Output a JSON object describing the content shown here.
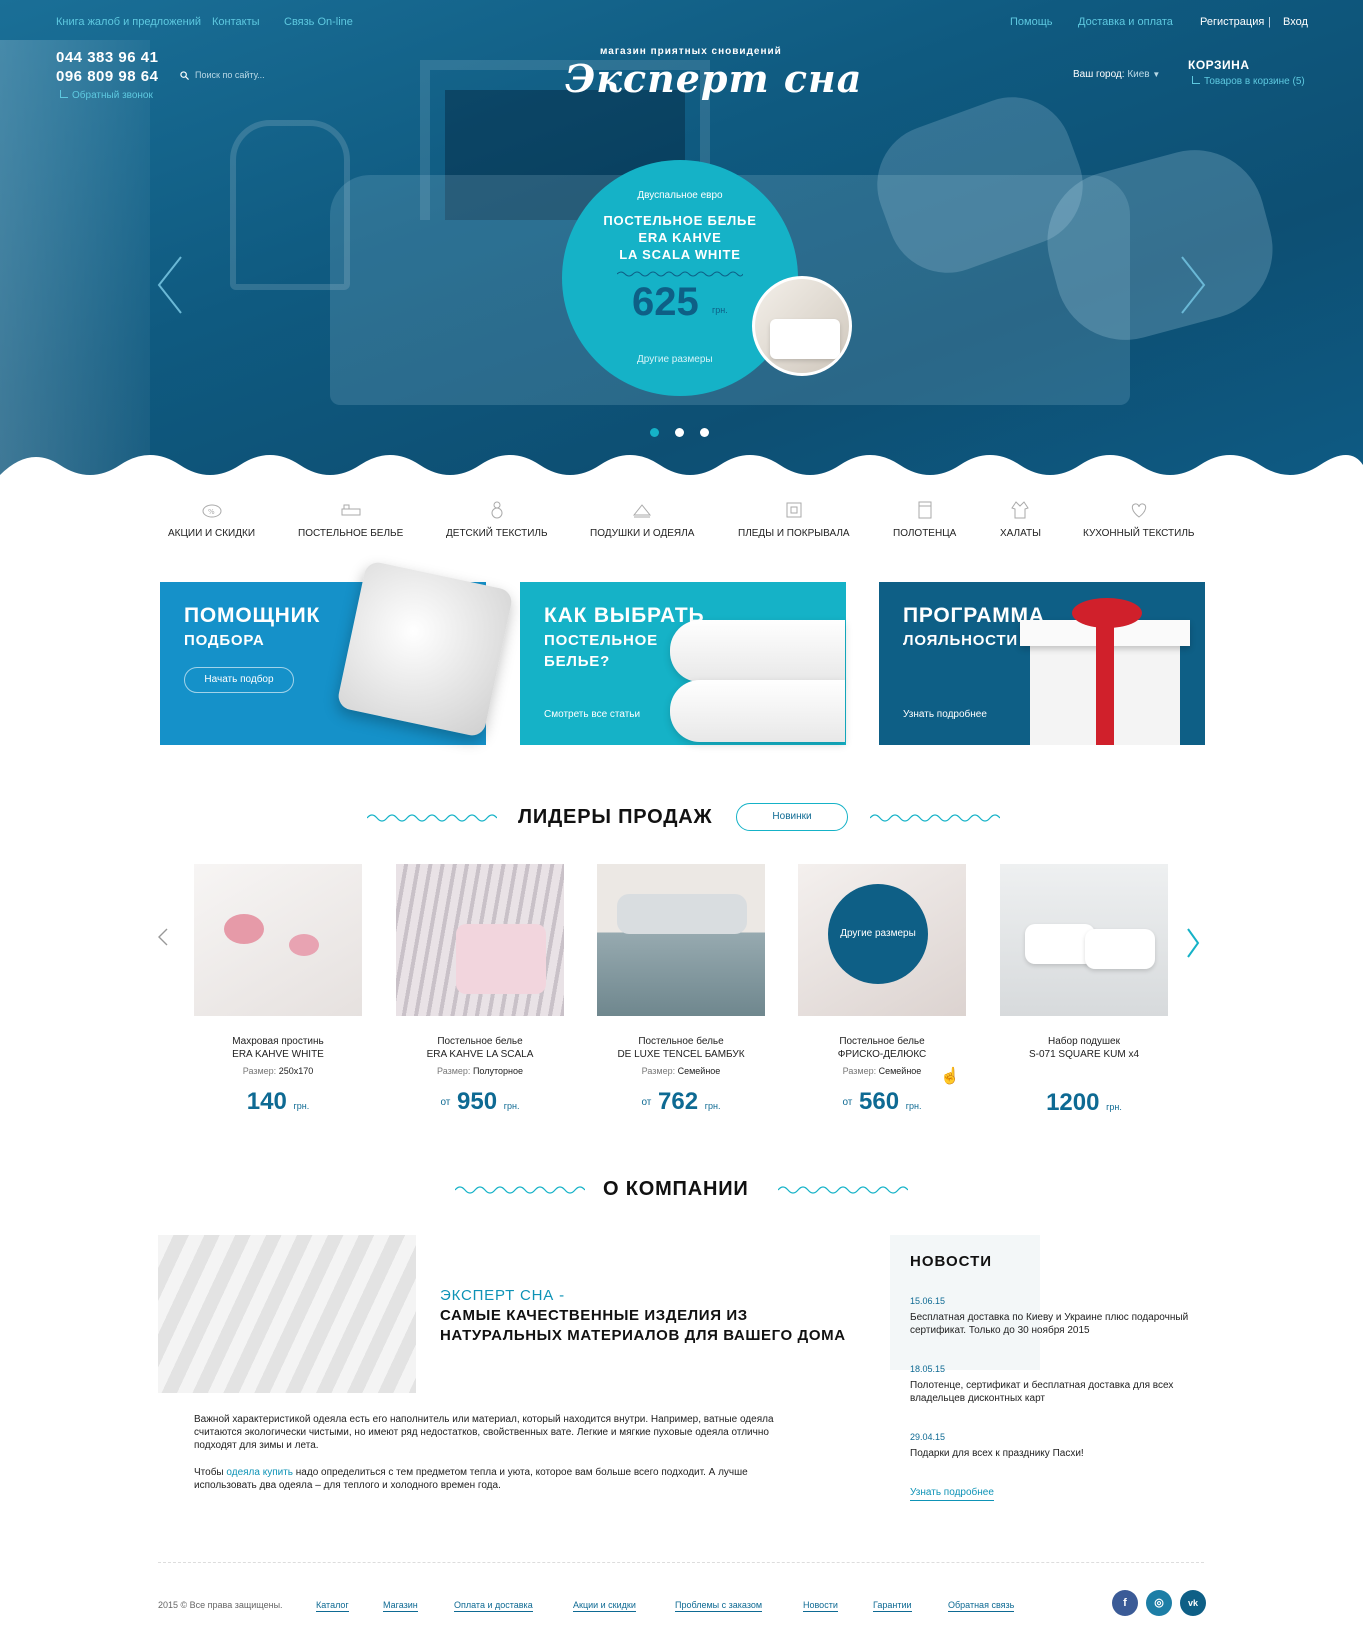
{
  "topbar": {
    "complaints": "Книга жалоб и предложений",
    "contacts": "Контакты",
    "online": "Связь On-line",
    "help": "Помощь",
    "delivery": "Доставка и оплата",
    "register": "Регистрация",
    "separator": "|",
    "login": "Вход"
  },
  "header": {
    "phone1": "044 383 96 41",
    "phone2": "096 809 98 64",
    "callback": "Обратный звонок",
    "search_placeholder": "Поиск по сайту...",
    "logo_sub": "магазин приятных сновидений",
    "logo": "Эксперт сна",
    "city_label": "Ваш город:",
    "city_value": "Киев",
    "cart_title": "КОРЗИНА",
    "cart_items": "Товаров в корзине (5)"
  },
  "slider": {
    "pre": "Двуспальное евро",
    "name_line1": "ПОСТЕЛЬНОЕ БЕЛЬЕ",
    "name_line2": "ERA KAHVE",
    "name_line3": "LA SCALA WHITE",
    "price": "625",
    "currency": "грн.",
    "sizes_link": "Другие размеры",
    "slides_total": 3,
    "active_slide": 1
  },
  "categories": [
    {
      "label": "АКЦИИ И СКИДКИ",
      "icon": "discount-tag-icon"
    },
    {
      "label": "ПОСТЕЛЬНОЕ БЕЛЬЕ",
      "icon": "bed-icon"
    },
    {
      "label": "ДЕТСКИЙ ТЕКСТИЛЬ",
      "icon": "baby-icon"
    },
    {
      "label": "ПОДУШКИ И ОДЕЯЛА",
      "icon": "pillow-icon"
    },
    {
      "label": "ПЛЕДЫ И ПОКРЫВАЛА",
      "icon": "blanket-icon"
    },
    {
      "label": "ПОЛОТЕНЦА",
      "icon": "towel-icon"
    },
    {
      "label": "ХАЛАТЫ",
      "icon": "robe-icon"
    },
    {
      "label": "КУХОННЫЙ ТЕКСТИЛЬ",
      "icon": "kitchen-icon"
    }
  ],
  "banners": {
    "b1_title": "ПОМОЩНИК",
    "b1_sub": "ПОДБОРА",
    "b1_btn": "Начать подбор",
    "b2_title": "КАК ВЫБРАТЬ",
    "b2_sub1": "ПОСТЕЛЬНОЕ",
    "b2_sub2": "БЕЛЬЕ?",
    "b2_link": "Смотреть все статьи",
    "b3_title": "ПРОГРАММА",
    "b3_sub": "ЛОЯЛЬНОСТИ",
    "b3_link": "Узнать подробнее"
  },
  "leaders": {
    "title": "ЛИДЕРЫ ПРОДАЖ",
    "new_btn": "Новинки",
    "size_label": "Размер:",
    "from": "от",
    "currency": "грн.",
    "other_sizes": "Другие размеры",
    "products": [
      {
        "n1": "Махровая простинь",
        "n2": "ERA KAHVE WHITE",
        "size": "250x170",
        "price": "140",
        "from": false
      },
      {
        "n1": "Постельное белье",
        "n2": "ERA KAHVE LA SCALA",
        "size": "Полуторное",
        "price": "950",
        "from": true
      },
      {
        "n1": "Постельное белье",
        "n2": "DE LUXE TENCEL БАМБУК",
        "size": "Семейное",
        "price": "762",
        "from": true
      },
      {
        "n1": "Постельное белье",
        "n2": "ФРИСКО-ДЕЛЮКС",
        "size": "Семейное",
        "price": "560",
        "from": true
      },
      {
        "n1": "Набор подушек",
        "n2": "S-071 SQUARE KUM x4",
        "size": "",
        "price": "1200",
        "from": false
      }
    ]
  },
  "about": {
    "title": "О КОМПАНИИ",
    "h1": "ЭКСПЕРТ СНА  -",
    "h2": "САМЫЕ КАЧЕСТВЕННЫЕ ИЗДЕЛИЯ ИЗ НАТУРАЛЬНЫХ МАТЕРИАЛОВ ДЛЯ ВАШЕГО ДОМА",
    "p1": "Важной характеристикой одеяла есть его наполнитель или материал, который находится внутри. Например, ватные одеяла считаются экологически чистыми, но имеют ряд недостатков, свойственных вате. Легкие и мягкие пуховые одеяла отлично подходят для зимы и лета.",
    "p2_pre": "Чтобы ",
    "p2_link": "одеяла купить",
    "p2_post": " надо определиться с тем предметом тепла и уюта, которое вам больше всего подходит. А лучше использовать два одеяла – для теплого и холодного времен года."
  },
  "news": {
    "title": "НОВОСТИ",
    "items": [
      {
        "date": "15.06.15",
        "text": "Бесплатная доставка по Киеву и Украине плюс подарочный сертификат. Только до 30 ноября 2015"
      },
      {
        "date": "18.05.15",
        "text": "Полотенце, сертификат и бесплатная доставка для всех владельцев дисконтных карт"
      },
      {
        "date": "29.04.15",
        "text": "Подарки для всех к празднику Пасхи!"
      }
    ],
    "more": "Узнать подробнее"
  },
  "footer": {
    "copyright": "2015 © Все права защищены.",
    "links": [
      "Каталог",
      "Магазин",
      "Оплата и доставка",
      "Акции и скидки",
      "Проблемы с заказом",
      "Новости",
      "Гарантии",
      "Обратная связь"
    ],
    "social": [
      "f",
      "◎",
      "vk"
    ]
  },
  "colors": {
    "hero": "#0f5a80",
    "accent": "#15b2c7",
    "brand_dark": "#0e5f86",
    "banner1": "#1591c9",
    "banner2": "#15b2c7",
    "banner3": "#0e5f86"
  }
}
